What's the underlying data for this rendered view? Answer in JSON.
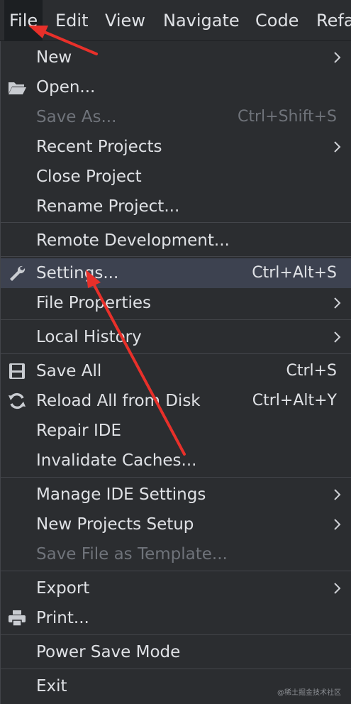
{
  "menubar": {
    "items": [
      {
        "label": "File"
      },
      {
        "label": "Edit"
      },
      {
        "label": "View"
      },
      {
        "label": "Navigate"
      },
      {
        "label": "Code"
      },
      {
        "label": "Refa"
      }
    ],
    "active": "File"
  },
  "menu": {
    "items": [
      {
        "label": "New",
        "submenu": true
      },
      {
        "label": "Open...",
        "icon": "folder-open-icon"
      },
      {
        "label": "Save As...",
        "shortcut": "Ctrl+Shift+S",
        "disabled": true
      },
      {
        "label": "Recent Projects",
        "submenu": true
      },
      {
        "label": "Close Project"
      },
      {
        "label": "Rename Project..."
      },
      {
        "label": "Remote Development..."
      },
      {
        "label": "Settings...",
        "shortcut": "Ctrl+Alt+S",
        "icon": "wrench-icon",
        "highlighted": true
      },
      {
        "label": "File Properties",
        "submenu": true
      },
      {
        "label": "Local History",
        "submenu": true
      },
      {
        "label": "Save All",
        "shortcut": "Ctrl+S",
        "icon": "save-icon"
      },
      {
        "label": "Reload All from Disk",
        "shortcut": "Ctrl+Alt+Y",
        "icon": "reload-icon"
      },
      {
        "label": "Repair IDE"
      },
      {
        "label": "Invalidate Caches..."
      },
      {
        "label": "Manage IDE Settings",
        "submenu": true
      },
      {
        "label": "New Projects Setup",
        "submenu": true
      },
      {
        "label": "Save File as Template...",
        "disabled": true
      },
      {
        "label": "Export",
        "submenu": true
      },
      {
        "label": "Print...",
        "icon": "printer-icon"
      },
      {
        "label": "Power Save Mode"
      },
      {
        "label": "Exit"
      }
    ]
  },
  "watermark": "@稀土掘金技术社区",
  "colors": {
    "background": "#2b2d30",
    "menubar_active": "#1c1f22",
    "highlight": "#3d4250",
    "text": "#dfe1e5",
    "disabled_text": "#6f737a",
    "separator": "#43454a",
    "annotation_arrow": "#e8302a"
  }
}
